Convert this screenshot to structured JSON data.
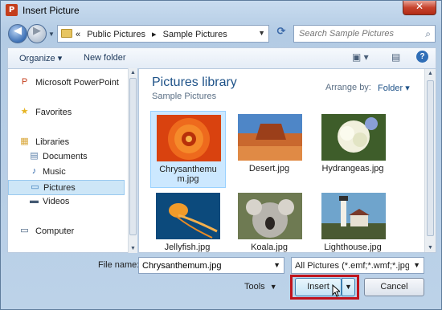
{
  "window": {
    "title": "Insert Picture",
    "close_glyph": "✕",
    "app_icon_letter": "P",
    "accent": "#1e5288",
    "highlight_color": "#c0141d"
  },
  "nav": {
    "back_glyph": "◀",
    "forward_glyph": "▶",
    "recent_glyph": "▼",
    "refresh_glyph": "⟳"
  },
  "address": {
    "chevron": "«",
    "crumbs": [
      "Public Pictures",
      "Sample Pictures"
    ],
    "separator": "▸"
  },
  "search": {
    "placeholder": "Search Sample Pictures",
    "icon": "search-icon"
  },
  "toolbar": {
    "organize": "Organize ▾",
    "new_folder": "New folder",
    "views_glyph": "▣ ▾",
    "preview_glyph": "▤",
    "help_glyph": "?"
  },
  "sidebar": {
    "items": [
      {
        "label": "Microsoft PowerPoint",
        "icon": "powerpoint-icon",
        "glyph": "P",
        "indent": 0,
        "color": "#c43e1c"
      },
      {
        "label": "Favorites",
        "icon": "star-icon",
        "glyph": "★",
        "indent": 0,
        "color": "#e6b422"
      },
      {
        "label": "Libraries",
        "icon": "libraries-icon",
        "glyph": "▦",
        "indent": 0,
        "color": "#d9a73a"
      },
      {
        "label": "Documents",
        "icon": "documents-icon",
        "glyph": "▤",
        "indent": 1,
        "color": "#5a7fa8"
      },
      {
        "label": "Music",
        "icon": "music-icon",
        "glyph": "♪",
        "indent": 1,
        "color": "#2c63a8"
      },
      {
        "label": "Pictures",
        "icon": "pictures-icon",
        "glyph": "▭",
        "indent": 1,
        "color": "#3b7bb8",
        "selected": true
      },
      {
        "label": "Videos",
        "icon": "videos-icon",
        "glyph": "▬",
        "indent": 1,
        "color": "#445a73"
      },
      {
        "label": "Computer",
        "icon": "computer-icon",
        "glyph": "▭",
        "indent": 0,
        "color": "#3c5a7a"
      }
    ]
  },
  "library": {
    "title": "Pictures library",
    "subtitle": "Sample Pictures",
    "arrange_label": "Arrange by:",
    "arrange_value": "Folder ▾"
  },
  "files": [
    {
      "name": "Chrysanthemum.jpg",
      "icon": "chrysanthemum-thumbnail",
      "selected": true
    },
    {
      "name": "Desert.jpg",
      "icon": "desert-thumbnail"
    },
    {
      "name": "Hydrangeas.jpg",
      "icon": "hydrangeas-thumbnail"
    },
    {
      "name": "Jellyfish.jpg",
      "icon": "jellyfish-thumbnail"
    },
    {
      "name": "Koala.jpg",
      "icon": "koala-thumbnail"
    },
    {
      "name": "Lighthouse.jpg",
      "icon": "lighthouse-thumbnail"
    }
  ],
  "filename": {
    "label": "File name:",
    "value": "Chrysanthemum.jpg"
  },
  "filetype": {
    "value": "All Pictures (*.emf;*.wmf;*.jpg;*"
  },
  "buttons": {
    "tools": "Tools",
    "insert": "Insert",
    "cancel": "Cancel",
    "dropdown_glyph": "▼"
  }
}
